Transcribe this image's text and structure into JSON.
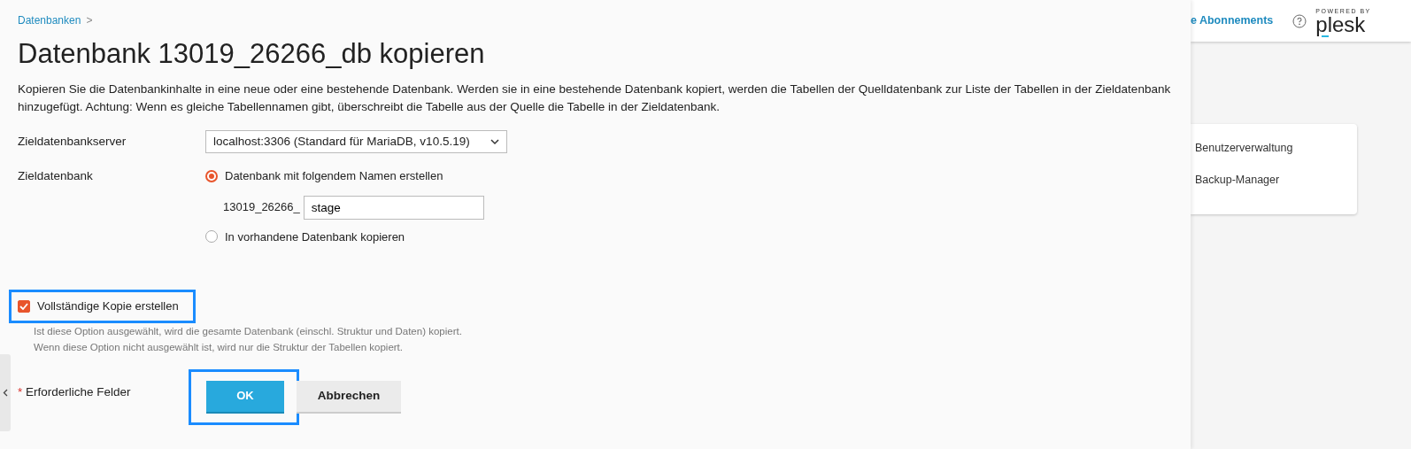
{
  "breadcrumb": [
    {
      "label": "Datenbanken",
      "separator": ">"
    }
  ],
  "title": "Datenbank 13019_26266_db kopieren",
  "description": "Kopieren Sie die Datenbankinhalte in eine neue oder eine bestehende Datenbank. Werden sie in eine bestehende Datenbank kopiert, werden die Tabellen der Quelldatenbank zur Liste der Tabellen in der Zieldatenbank hinzugefügt. Achtung: Wenn es gleiche Tabellennamen gibt, überschreibt die Tabelle aus der Quelle die Tabelle in der Zieldatenbank.",
  "form": {
    "server": {
      "label": "Zieldatenbankserver",
      "value": "localhost:3306 (Standard für MariaDB, v10.5.19)"
    },
    "target": {
      "label": "Zieldatenbank",
      "options": [
        {
          "label": "Datenbank mit folgendem Namen erstellen",
          "selected": true,
          "prefix": "13019_26266_",
          "value": "stage"
        },
        {
          "label": "In vorhandene Datenbank kopieren",
          "selected": false
        }
      ]
    },
    "full_copy": {
      "label": "Vollständige Kopie erstellen",
      "checked": true,
      "highlighted": true,
      "hint": "Ist diese Option ausgewählt, wird die gesamte Datenbank (einschl. Struktur und Daten) kopiert. Wenn diese Option nicht ausgewählt ist, wird nur die Struktur der Tabellen kopiert."
    },
    "required_note": {
      "mark": "*",
      "text": "Erforderliche Felder"
    },
    "buttons": [
      {
        "label": "OK",
        "kind": "primary",
        "highlighted": true
      },
      {
        "label": "Abbrechen",
        "kind": "secondary",
        "highlighted": false
      }
    ]
  },
  "header": {
    "link": "e Abonnements",
    "logo": {
      "tagline": "POWERED BY",
      "name": "plesk"
    }
  },
  "side_card": {
    "items": [
      "Benutzerverwaltung",
      "Backup-Manager"
    ]
  }
}
